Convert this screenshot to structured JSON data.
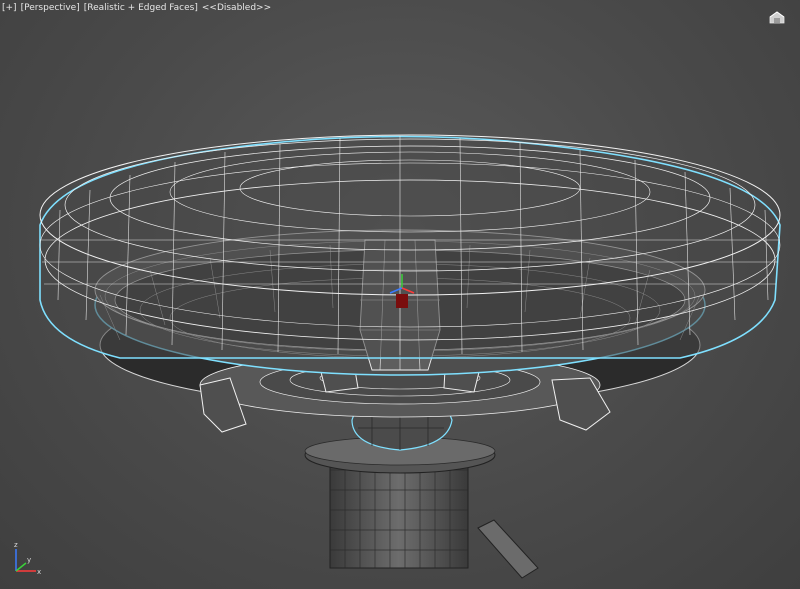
{
  "viewport": {
    "label_plus": "[+]",
    "label_view": "[Perspective]",
    "label_shading": "[Realistic + Edged Faces]",
    "label_state": "<<Disabled>>"
  },
  "icons": {
    "viewcube": "home-viewcube-icon",
    "axis": "axis-tripod-icon"
  },
  "axes": {
    "x": "x",
    "y": "y",
    "z": "z"
  },
  "colors": {
    "background": "#4a4a4a",
    "wire_white": "#f2f2f2",
    "selection_cyan": "#7fe0ff",
    "mesh_dark": "#2b2b2b",
    "mesh_mid": "#5c5c5c"
  }
}
